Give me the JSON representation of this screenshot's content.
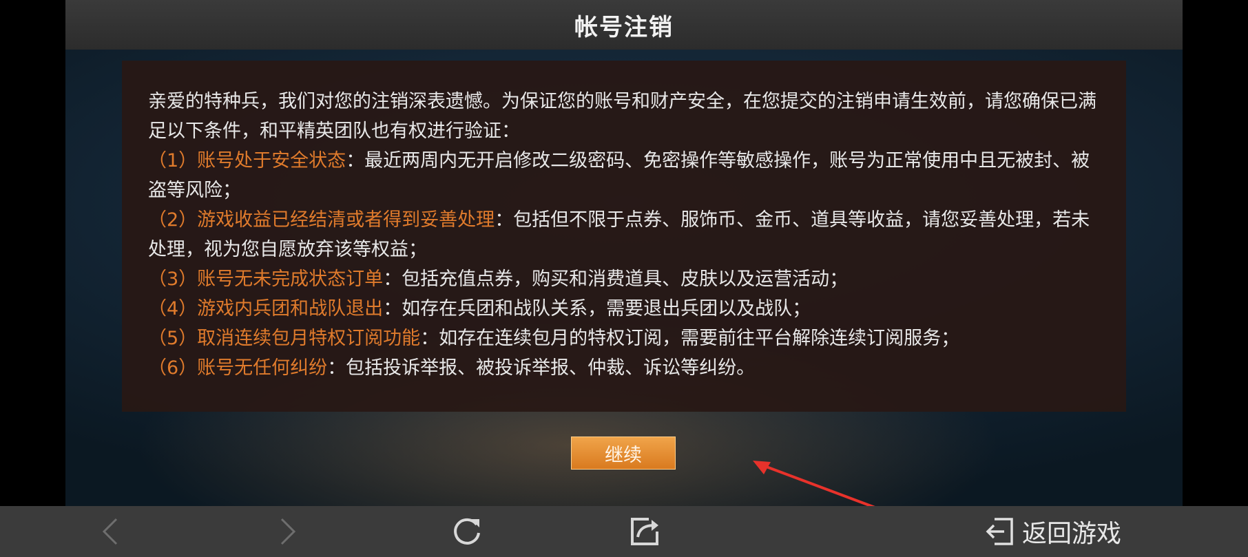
{
  "header": {
    "title": "帐号注销"
  },
  "notice": {
    "intro": "亲爱的特种兵，我们对您的注销深表遗憾。为保证您的账号和财产安全，在您提交的注销申请生效前，请您确保已满足以下条件，和平精英团队也有权进行验证：",
    "conditions": [
      {
        "head": "（1）账号处于安全状态",
        "body": "：最近两周内无开启修改二级密码、免密操作等敏感操作，账号为正常使用中且无被封、被盗等风险；"
      },
      {
        "head": "（2）游戏收益已经结清或者得到妥善处理",
        "body": "：包括但不限于点券、服饰币、金币、道具等收益，请您妥善处理，若未处理，视为您自愿放弃该等权益；"
      },
      {
        "head": "（3）账号无未完成状态订单",
        "body": "：包括充值点券，购买和消费道具、皮肤以及运营活动；"
      },
      {
        "head": "（4）游戏内兵团和战队退出",
        "body": "：如存在兵团和战队关系，需要退出兵团以及战队；"
      },
      {
        "head": "（5）取消连续包月特权订阅功能",
        "body": "：如存在连续包月的特权订阅，需要前往平台解除连续订阅服务；"
      },
      {
        "head": "（6）账号无任何纠纷",
        "body": "：包括投诉举报、被投诉举报、仲裁、诉讼等纠纷。"
      }
    ]
  },
  "actions": {
    "continue_label": "继续"
  },
  "toolbar": {
    "back_icon": "chevron-left-icon",
    "forward_icon": "chevron-right-icon",
    "refresh_icon": "refresh-icon",
    "share_icon": "share-icon",
    "return_icon": "exit-icon",
    "return_label": "返回游戏"
  },
  "colors": {
    "highlight": "#e07b2c",
    "button": "#e8902f",
    "annotation_arrow": "#e8322b"
  }
}
